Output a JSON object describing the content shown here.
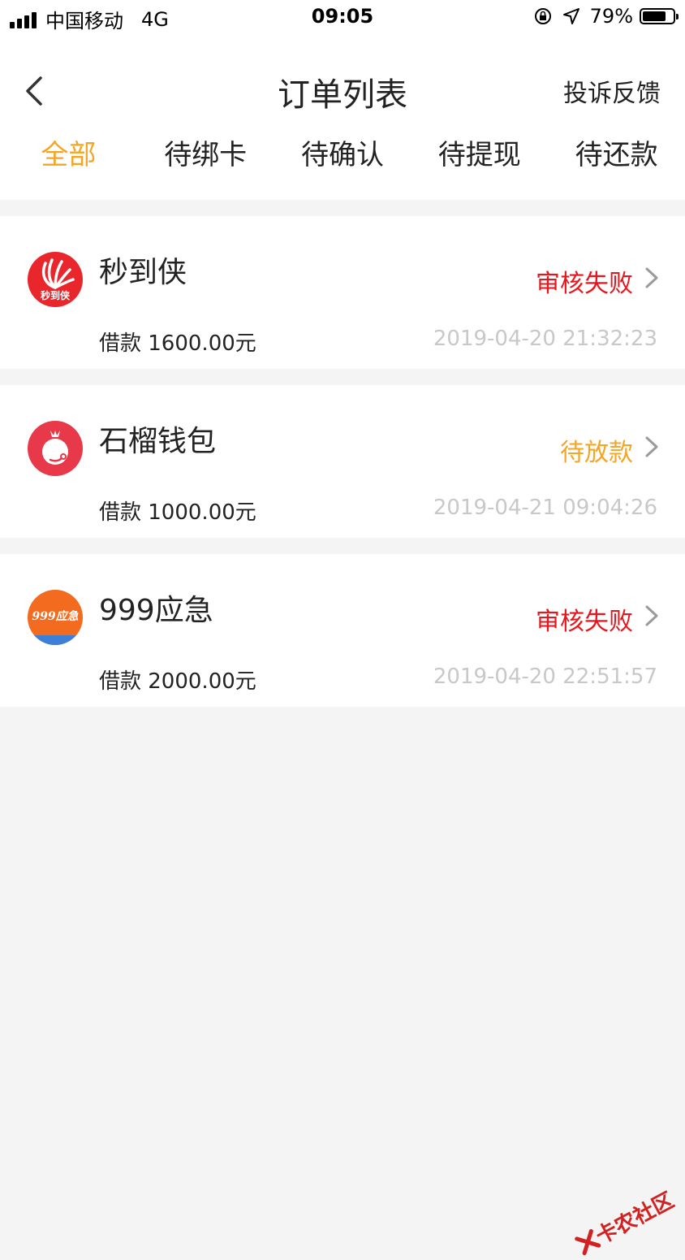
{
  "status_bar": {
    "carrier": "中国移动",
    "network": "4G",
    "time": "09:05",
    "battery": "79%",
    "battery_level": 0.79
  },
  "nav": {
    "title": "订单列表",
    "action": "投诉反馈"
  },
  "tabs": [
    {
      "label": "全部",
      "active": true
    },
    {
      "label": "待绑卡",
      "active": false
    },
    {
      "label": "待确认",
      "active": false
    },
    {
      "label": "待提现",
      "active": false
    },
    {
      "label": "待还款",
      "active": false
    }
  ],
  "orders": [
    {
      "name": "秒到侠",
      "logo_text": "秒到侠",
      "status": "审核失败",
      "status_color": "#e8161c",
      "amount": "借款 1600.00元",
      "time": "2019-04-20 21:32:23"
    },
    {
      "name": "石榴钱包",
      "status": "待放款",
      "status_color": "#f5a524",
      "amount": "借款 1000.00元",
      "time": "2019-04-21 09:04:26"
    },
    {
      "name": "999应急",
      "logo_text": "999应急",
      "status": "审核失败",
      "status_color": "#e8161c",
      "amount": "借款 2000.00元",
      "time": "2019-04-20 22:51:57"
    }
  ],
  "watermark": "卡农社区",
  "colors": {
    "accent": "#f5a524",
    "fail": "#e8161c",
    "muted": "#c8c8c8"
  }
}
